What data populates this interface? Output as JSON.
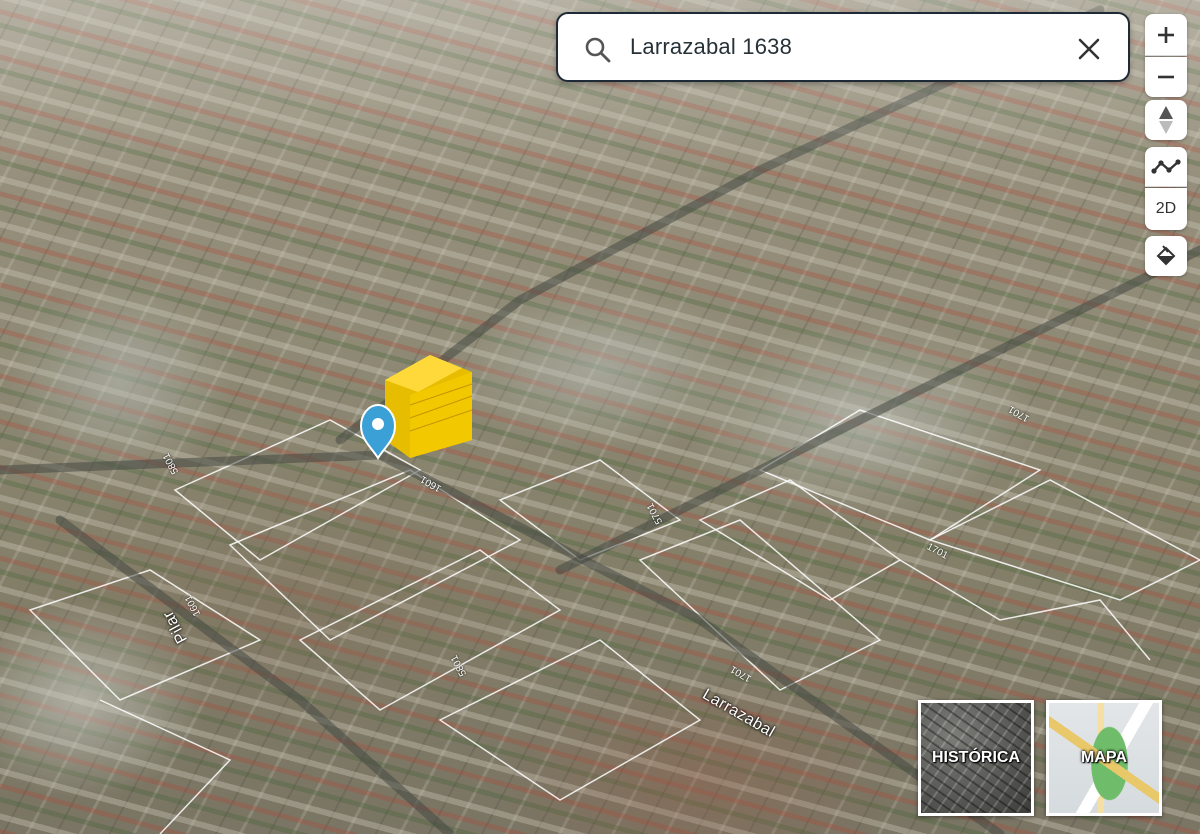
{
  "search": {
    "query": "Larrazabal 1638",
    "icon": "search-icon",
    "clear_icon": "close-icon"
  },
  "toolbar": {
    "zoom_in_icon": "plus-icon",
    "zoom_out_icon": "minus-icon",
    "compass_icon": "compass-icon",
    "measure_icon": "path-measure-icon",
    "view_mode_label": "2D",
    "paint_icon": "paint-bucket-icon"
  },
  "map": {
    "streets": [
      "Larrazabal",
      "Pilar"
    ],
    "house_numbers": [
      "1601",
      "1701",
      "5801",
      "5801",
      "1701",
      "5701",
      "1601",
      "1701"
    ],
    "marker_color": "#3aa0d6",
    "building_color": "#f0c800"
  },
  "layers": {
    "historica_label": "HISTÓRICA",
    "mapa_label": "MAPA"
  }
}
